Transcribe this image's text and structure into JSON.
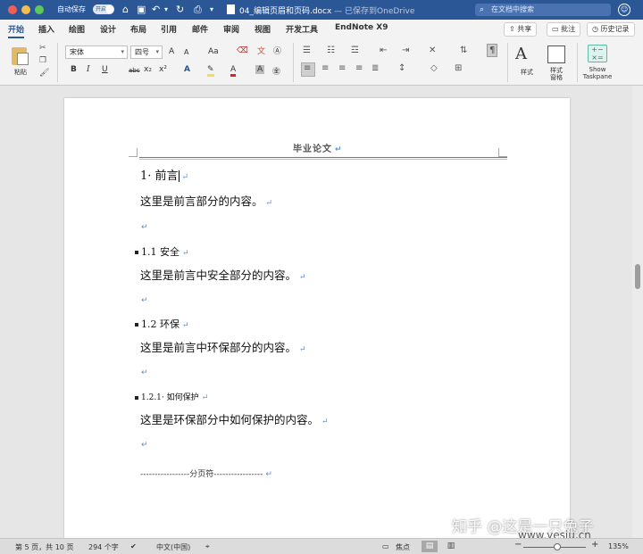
{
  "titlebar": {
    "autosave_label": "自动保存",
    "autosave_state": "开启",
    "doc_name": "04_编辑页眉和页码.docx",
    "doc_status": " — 已保存到OneDrive",
    "search_placeholder": "在文档中搜索",
    "icons": [
      "home-icon",
      "save-icon",
      "undo-icon",
      "redo-icon",
      "print-icon",
      "more-icon"
    ]
  },
  "ribbon_tabs": {
    "items": [
      "开始",
      "插入",
      "绘图",
      "设计",
      "布局",
      "引用",
      "邮件",
      "审阅",
      "视图",
      "开发工具",
      "EndNote X9"
    ],
    "active": "开始",
    "share": "共享",
    "comment": "批注",
    "history": "历史记录"
  },
  "ribbon": {
    "paste": "粘贴",
    "font_name": "宋体",
    "font_size": "四号",
    "grow_font": "A",
    "shrink_font": "A",
    "change_case": "Aa",
    "bold": "B",
    "italic": "I",
    "underline": "U",
    "strike": "abc",
    "subscript": "x₂",
    "superscript": "x²",
    "styles": "样式",
    "styles_pane": "样式\n窗格",
    "show_taskpane": "Show\nTaskpane"
  },
  "document": {
    "header": "毕业论文",
    "lines": [
      {
        "kind": "h1",
        "text": "1· 前言"
      },
      {
        "kind": "body",
        "text": "这里是前言部分的内容。"
      },
      {
        "kind": "h2",
        "text": "1.1 安全"
      },
      {
        "kind": "body",
        "text": "这里是前言中安全部分的内容。"
      },
      {
        "kind": "h2",
        "text": "1.2 环保"
      },
      {
        "kind": "body",
        "text": "这里是前言中环保部分的内容。"
      },
      {
        "kind": "h3",
        "text": "1.2.1· 如何保护"
      },
      {
        "kind": "body",
        "text": "这里是环保部分中如何保护的内容。"
      }
    ],
    "paragraph_mark": "↵",
    "page_break": "-----------------分页符-----------------"
  },
  "watermark": {
    "line1": "知乎 @这是一只兔子",
    "line2": "www.yesiu.cn"
  },
  "statusbar": {
    "page": "第 5 页，共 10 页",
    "words": "294 个字",
    "language": "中文(中国)",
    "focus": "焦点",
    "zoom": "135%",
    "zoom_fraction": 0.5
  },
  "colors": {
    "titlebar": "#2b5797",
    "accent": "#2b5797",
    "paragraph_mark": "#5b8dd6"
  }
}
